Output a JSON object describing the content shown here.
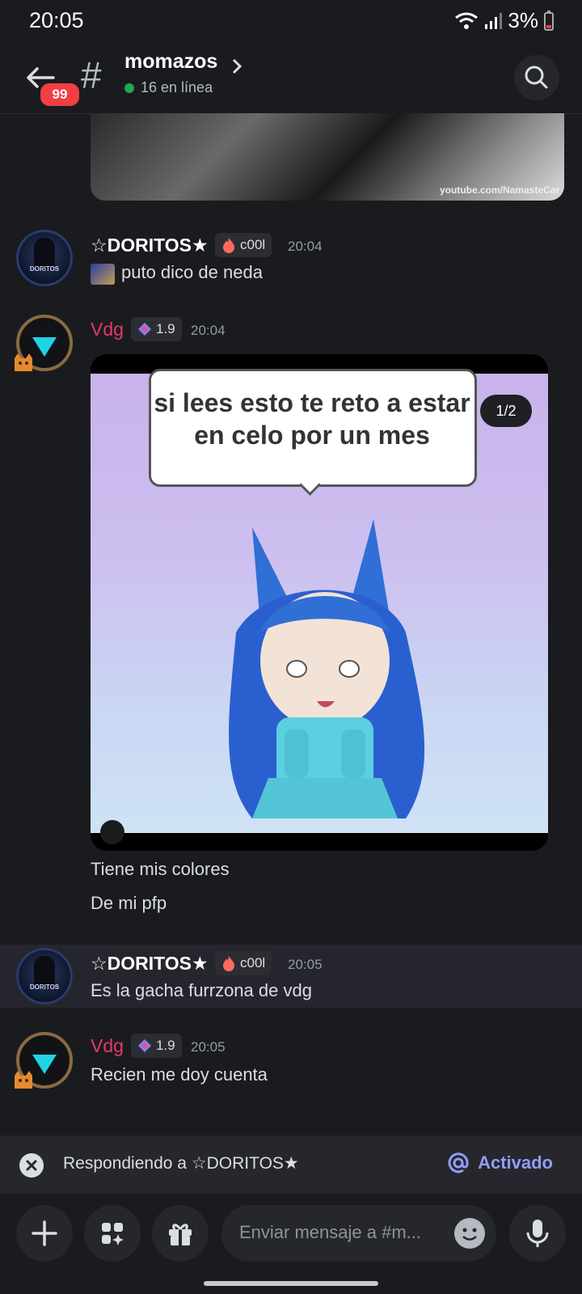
{
  "status_bar": {
    "time": "20:05",
    "battery": "3%"
  },
  "header": {
    "unread_badge": "99",
    "channel_symbol": "#",
    "channel_name": "momazos",
    "online": "16 en línea"
  },
  "top_image": {
    "watermark": "youtube.com/NamasteCar"
  },
  "messages": [
    {
      "author": "☆DORITOS★",
      "tag": "c00l",
      "time": "20:04",
      "text": "puto dico de neda"
    },
    {
      "author": "Vdg",
      "tag": "1.9",
      "time": "20:04",
      "image_text": "si lees esto te reto a estar en celo por un mes",
      "image_counter": "1/2",
      "lines": [
        "Tiene mis colores",
        "De mi pfp"
      ]
    },
    {
      "author": "☆DORITOS★",
      "tag": "c00l",
      "time": "20:05",
      "text": "Es la gacha furrzona de vdg"
    },
    {
      "author": "Vdg",
      "tag": "1.9",
      "time": "20:05",
      "text": "Recien me doy cuenta"
    }
  ],
  "reply_bar": {
    "text": "Respondiendo a ☆DORITOS★",
    "mention_toggle": "Activado"
  },
  "composer": {
    "placeholder": "Enviar mensaje a #m..."
  },
  "colors": {
    "background": "#1a1b1f",
    "accent": "#949cf7",
    "vdg_name": "#e8356b",
    "online": "#23a55a",
    "badge": "#f23f43"
  },
  "icons": [
    "back-arrow-icon",
    "hash-icon",
    "chevron-right-icon",
    "search-icon",
    "close-icon",
    "at-icon",
    "plus-icon",
    "apps-icon",
    "gift-icon",
    "emoji-icon",
    "mic-icon"
  ]
}
